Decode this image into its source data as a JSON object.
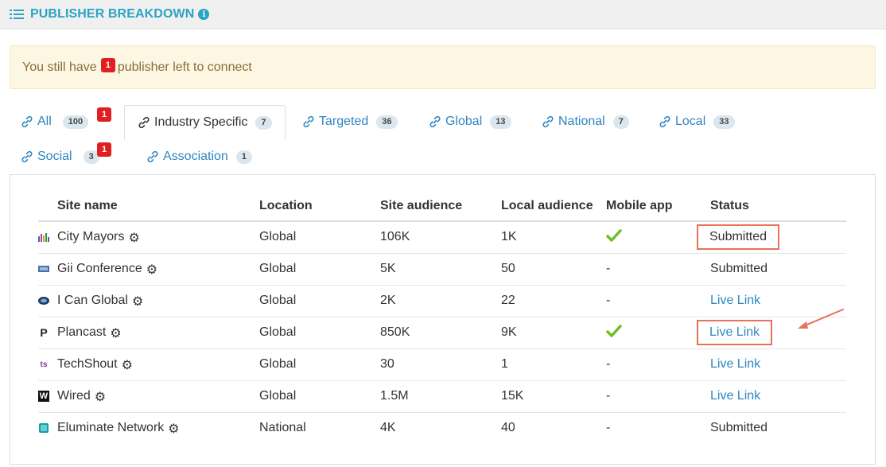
{
  "header": {
    "title": "PUBLISHER BREAKDOWN",
    "info_glyph": "i"
  },
  "alert": {
    "prefix": "You still have",
    "count": "1",
    "suffix": "publisher left to connect"
  },
  "tabs": [
    {
      "label": "All",
      "count": "100",
      "badge": "1",
      "active": false
    },
    {
      "label": "Industry Specific",
      "count": "7",
      "active": true
    },
    {
      "label": "Targeted",
      "count": "36",
      "active": false
    },
    {
      "label": "Global",
      "count": "13",
      "active": false
    },
    {
      "label": "National",
      "count": "7",
      "active": false
    },
    {
      "label": "Local",
      "count": "33",
      "active": false
    },
    {
      "label": "Social",
      "count": "3",
      "badge": "1",
      "active": false
    },
    {
      "label": "Association",
      "count": "1",
      "active": false
    }
  ],
  "table": {
    "headers": [
      "Site name",
      "Location",
      "Site audience",
      "Local audience",
      "Mobile app",
      "Status"
    ],
    "rows": [
      {
        "site": "City Mayors",
        "icon": "city-mayors-icon",
        "location": "Global",
        "site_audience": "106K",
        "local_audience": "1K",
        "mobile": "check",
        "status": "Submitted",
        "status_type": "text",
        "highlight": true
      },
      {
        "site": "Gii Conference",
        "icon": "gii-conference-icon",
        "location": "Global",
        "site_audience": "5K",
        "local_audience": "50",
        "mobile": "-",
        "status": "Submitted",
        "status_type": "text",
        "highlight": false
      },
      {
        "site": "I Can Global",
        "icon": "i-can-global-icon",
        "location": "Global",
        "site_audience": "2K",
        "local_audience": "22",
        "mobile": "-",
        "status": "Live Link",
        "status_type": "link",
        "highlight": false
      },
      {
        "site": "Plancast",
        "icon": "plancast-icon",
        "location": "Global",
        "site_audience": "850K",
        "local_audience": "9K",
        "mobile": "check",
        "status": "Live Link",
        "status_type": "link",
        "highlight": true
      },
      {
        "site": "TechShout",
        "icon": "techshout-icon",
        "location": "Global",
        "site_audience": "30",
        "local_audience": "1",
        "mobile": "-",
        "status": "Live Link",
        "status_type": "link",
        "highlight": false
      },
      {
        "site": "Wired",
        "icon": "wired-icon",
        "location": "Global",
        "site_audience": "1.5M",
        "local_audience": "15K",
        "mobile": "-",
        "status": "Live Link",
        "status_type": "link",
        "highlight": false
      },
      {
        "site": "Eluminate Network",
        "icon": "eluminate-network-icon",
        "location": "National",
        "site_audience": "4K",
        "local_audience": "40",
        "mobile": "-",
        "status": "Submitted",
        "status_type": "text",
        "highlight": false
      }
    ]
  },
  "favicon_glyphs": {
    "plancast": "P",
    "wired": "W",
    "techshout": "ts"
  },
  "colors": {
    "accent": "#2aa3c4",
    "link": "#2e86c1",
    "alert_bg": "#fcf6e2",
    "badge_red": "#e02020",
    "highlight": "#e9705a",
    "check": "#6bbf2a"
  }
}
